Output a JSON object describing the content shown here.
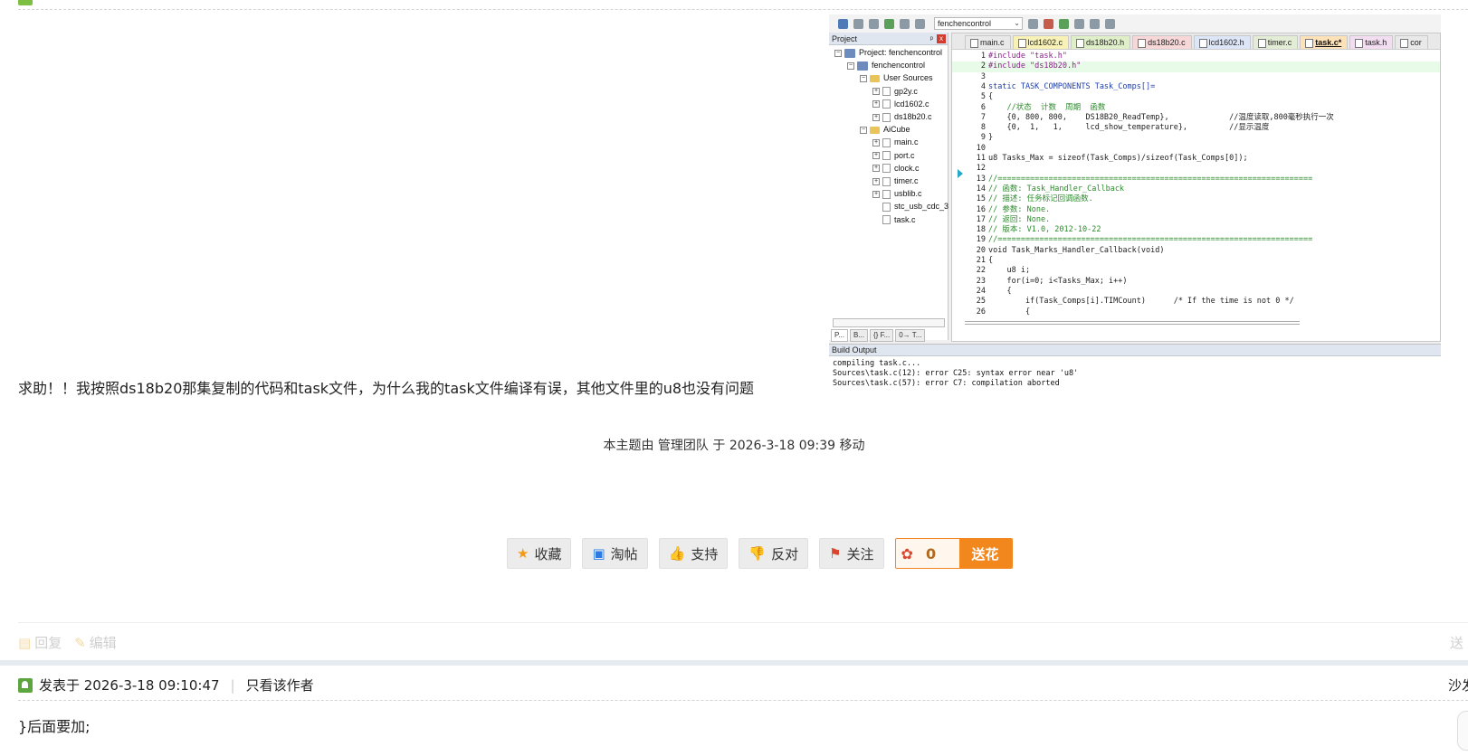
{
  "screenshot": {
    "combo": "fenchencontrol",
    "project_title": "Project",
    "tree": [
      {
        "label": "Project: fenchencontrol",
        "kind": "project"
      },
      {
        "label": "fenchencontrol",
        "kind": "target"
      },
      {
        "label": "User Sources",
        "kind": "folder"
      },
      {
        "label": "gp2y.c",
        "kind": "file"
      },
      {
        "label": "lcd1602.c",
        "kind": "file"
      },
      {
        "label": "ds18b20.c",
        "kind": "file"
      },
      {
        "label": "AiCube",
        "kind": "folder"
      },
      {
        "label": "main.c",
        "kind": "file"
      },
      {
        "label": "port.c",
        "kind": "file"
      },
      {
        "label": "clock.c",
        "kind": "file"
      },
      {
        "label": "timer.c",
        "kind": "file"
      },
      {
        "label": "usblib.c",
        "kind": "file"
      },
      {
        "label": "stc_usb_cdc_3",
        "kind": "file"
      },
      {
        "label": "task.c",
        "kind": "file"
      }
    ],
    "panel_tabs": [
      "P...",
      "B...",
      "{} F...",
      "0→ T..."
    ],
    "file_tabs": [
      {
        "label": "main.c",
        "bg": "#e9e9e9",
        "color": "#222"
      },
      {
        "label": "lcd1602.c",
        "bg": "#f8f2b7",
        "color": "#222"
      },
      {
        "label": "ds18b20.h",
        "bg": "#dff0c9",
        "color": "#222"
      },
      {
        "label": "ds18b20.c",
        "bg": "#f7d7d7",
        "color": "#222"
      },
      {
        "label": "lcd1602.h",
        "bg": "#dde6f7",
        "color": "#222"
      },
      {
        "label": "timer.c",
        "bg": "#e3ecd4",
        "color": "#222"
      },
      {
        "label": "task.c*",
        "bg": "#fde2b9",
        "color": "#111"
      },
      {
        "label": "task.h",
        "bg": "#f3ddf0",
        "color": "#222"
      },
      {
        "label": "cor",
        "bg": "#e9e9e9",
        "color": "#222"
      }
    ],
    "code_lines": [
      {
        "n": "1",
        "t": "#include \"task.h\"",
        "c": "st"
      },
      {
        "n": "2",
        "t": "#include \"ds18b20.h\"",
        "c": "st",
        "hl": true
      },
      {
        "n": "3",
        "t": "",
        "c": "tx"
      },
      {
        "n": "4",
        "t": "static TASK_COMPONENTS Task_Comps[]=",
        "c": "kw"
      },
      {
        "n": "5",
        "t": "{",
        "c": "tx"
      },
      {
        "n": "6",
        "t": "    //状态  计数  周期  函数",
        "c": "cm"
      },
      {
        "n": "7",
        "t": "    {0, 800, 800,    DS18B20_ReadTemp},             //温度读取,800毫秒执行一次",
        "c": "tx"
      },
      {
        "n": "8",
        "t": "    {0,  1,   1,     lcd_show_temperature},         //显示温度",
        "c": "tx"
      },
      {
        "n": "9",
        "t": "}",
        "c": "tx"
      },
      {
        "n": "10",
        "t": "",
        "c": "tx"
      },
      {
        "n": "11",
        "t": "u8 Tasks_Max = sizeof(Task_Comps)/sizeof(Task_Comps[0]);",
        "c": "tx"
      },
      {
        "n": "12",
        "t": "",
        "c": "tx"
      },
      {
        "n": "13",
        "t": "//====================================================================",
        "c": "cm"
      },
      {
        "n": "14",
        "t": "// 函数: Task_Handler_Callback",
        "c": "cm"
      },
      {
        "n": "15",
        "t": "// 描述: 任务标记回调函数.",
        "c": "cm"
      },
      {
        "n": "16",
        "t": "// 参数: None.",
        "c": "cm"
      },
      {
        "n": "17",
        "t": "// 返回: None.",
        "c": "cm"
      },
      {
        "n": "18",
        "t": "// 版本: V1.0, 2012-10-22",
        "c": "cm"
      },
      {
        "n": "19",
        "t": "//====================================================================",
        "c": "cm"
      },
      {
        "n": "20",
        "t": "void Task_Marks_Handler_Callback(void)",
        "c": "tx"
      },
      {
        "n": "21",
        "t": "{",
        "c": "tx"
      },
      {
        "n": "22",
        "t": "    u8 i;",
        "c": "tx"
      },
      {
        "n": "23",
        "t": "    for(i=0; i<Tasks_Max; i++)",
        "c": "tx"
      },
      {
        "n": "24",
        "t": "    {",
        "c": "tx"
      },
      {
        "n": "25",
        "t": "        if(Task_Comps[i].TIMCount)      /* If the time is not 0 */",
        "c": "tx"
      },
      {
        "n": "26",
        "t": "        {",
        "c": "tx"
      }
    ],
    "build_title": "Build Output",
    "build_lines": "compiling task.c...\nSources\\task.c(12): error C25: syntax error near 'u8'\nSources\\task.c(57): error C7: compilation aborted"
  },
  "post": {
    "question": "求助！！我按照ds18b20那集复制的代码和task文件，为什么我的task文件编译有误，其他文件里的u8也没有问题",
    "moved_note": "本主题由 管理团队 于 2026-3-18 09:39 移动"
  },
  "actions": {
    "favorite": "收藏",
    "taotie": "淘帖",
    "support": "支持",
    "oppose": "反对",
    "follow": "关注",
    "flower_count": "0",
    "send_flower": "送花"
  },
  "reply_bar": {
    "reply": "回复",
    "edit": "编辑",
    "right": "送"
  },
  "second_post": {
    "posted_at": "发表于 2026-3-18 09:10:47",
    "only_author": "只看该作者",
    "floor": "沙发",
    "content": "}后面要加;"
  }
}
